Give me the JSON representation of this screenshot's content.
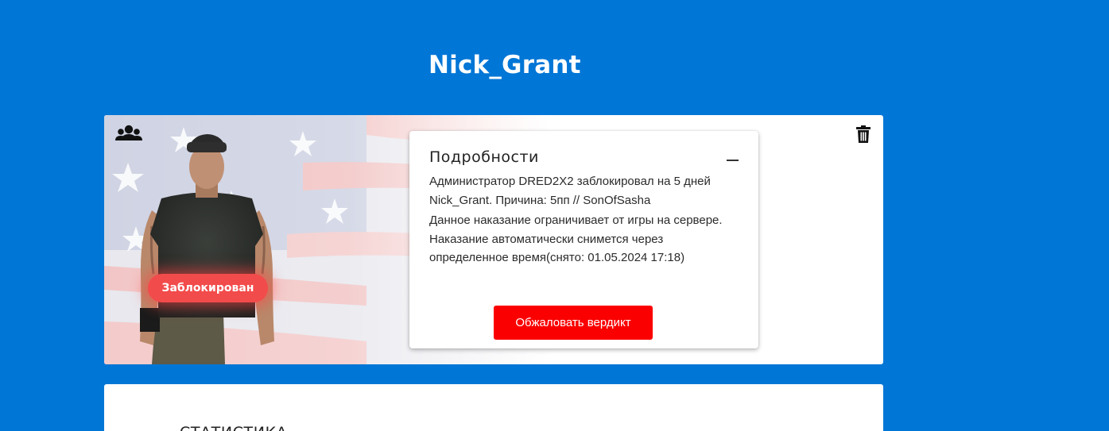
{
  "profile": {
    "nickname": "Nick_Grant",
    "status_badge": "Заблокирован"
  },
  "icons": {
    "group": "users-group-icon",
    "delete": "trash-icon",
    "collapse": "minus-icon"
  },
  "details": {
    "title": "Подробности",
    "collapse_symbol": "—",
    "description": "Администратор DRED2X2 заблокировал на 5 дней Nick_Grant. Причина: 5пп // SonOfSasha",
    "info": "Данное наказание ограничивает от игры на сервере. Наказание автоматически снимется через определенное время(снято: 01.05.2024 17:18)",
    "appeal_button": "Обжаловать вердикт"
  },
  "stats": {
    "title": "СТАТИСТИКА"
  },
  "colors": {
    "background": "#0076d6",
    "badge": "#f24b4b",
    "appeal_button": "#fa0000",
    "card": "#ffffff"
  }
}
